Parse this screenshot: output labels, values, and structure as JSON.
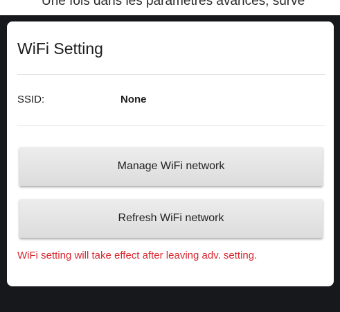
{
  "top_caption": "Une fois dans les paramètres avancés, surve",
  "dialog": {
    "title": "WiFi Setting",
    "ssid_label": "SSID:",
    "ssid_value": "None",
    "manage_button_label": "Manage WiFi network",
    "refresh_button_label": "Refresh WiFi network",
    "warning_text": "WiFi setting will take effect after leaving adv. setting."
  },
  "colors": {
    "warning": "#d9262e",
    "backdrop": "#16181c",
    "button": "#e4e4e4"
  }
}
